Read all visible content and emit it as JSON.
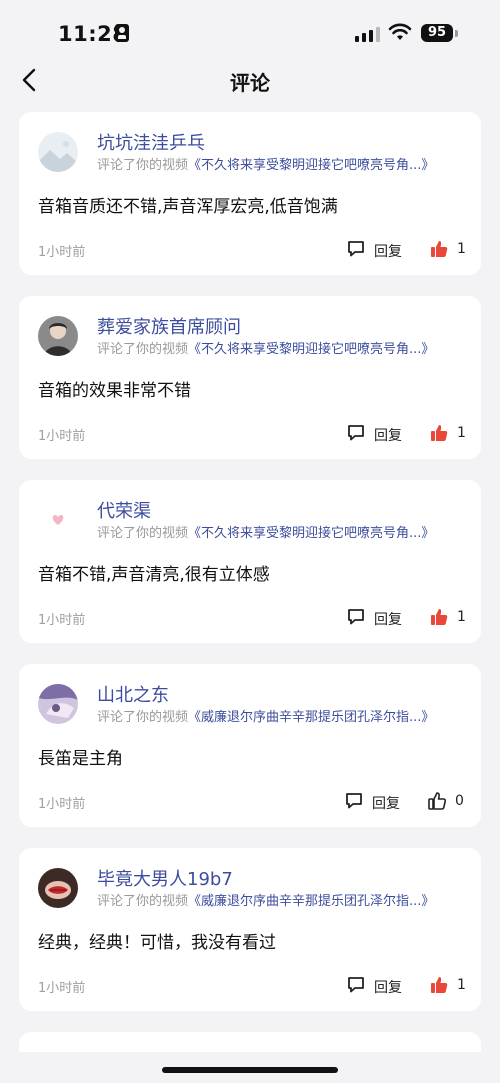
{
  "status_bar": {
    "time": "11:28",
    "battery": "95"
  },
  "header": {
    "title": "评论"
  },
  "comments": [
    {
      "username": "坑坑洼洼乒乓",
      "action": "评论了你的视频",
      "video": "《不久将来享受黎明迎接它吧嘹亮号角...》",
      "text": "音箱音质还不错,声音浑厚宏亮,低音饱满",
      "time": "1小时前",
      "reply": "回复",
      "likes": "1",
      "liked": true,
      "avatar": "landscape"
    },
    {
      "username": "葬爱家族首席顾问",
      "action": "评论了你的视频",
      "video": "《不久将来享受黎明迎接它吧嘹亮号角...》",
      "text": "音箱的效果非常不错",
      "time": "1小时前",
      "reply": "回复",
      "likes": "1",
      "liked": true,
      "avatar": "portrait-dark"
    },
    {
      "username": "代荣渠",
      "action": "评论了你的视频",
      "video": "《不久将来享受黎明迎接它吧嘹亮号角...》",
      "text": "音箱不错,声音清亮,很有立体感",
      "time": "1小时前",
      "reply": "回复",
      "likes": "1",
      "liked": true,
      "avatar": "heart"
    },
    {
      "username": "山北之东",
      "action": "评论了你的视频",
      "video": "《威廉退尔序曲辛辛那提乐团孔泽尔指...》",
      "text": "長笛是主角",
      "time": "1小时前",
      "reply": "回复",
      "likes": "0",
      "liked": false,
      "avatar": "purple"
    },
    {
      "username": "毕竟大男人19b7",
      "action": "评论了你的视频",
      "video": "《威廉退尔序曲辛辛那提乐团孔泽尔指...》",
      "text": "经典，经典！可惜，我没有看过",
      "time": "1小时前",
      "reply": "回复",
      "likes": "1",
      "liked": true,
      "avatar": "red-lips"
    }
  ],
  "colors": {
    "link": "#3d4d9d",
    "like": "#e8483a",
    "muted": "#999999",
    "background": "#f3f3f5"
  },
  "icons": {
    "back": "chevron-left-icon",
    "reply": "speech-bubble-icon",
    "like": "thumbs-up-icon"
  }
}
